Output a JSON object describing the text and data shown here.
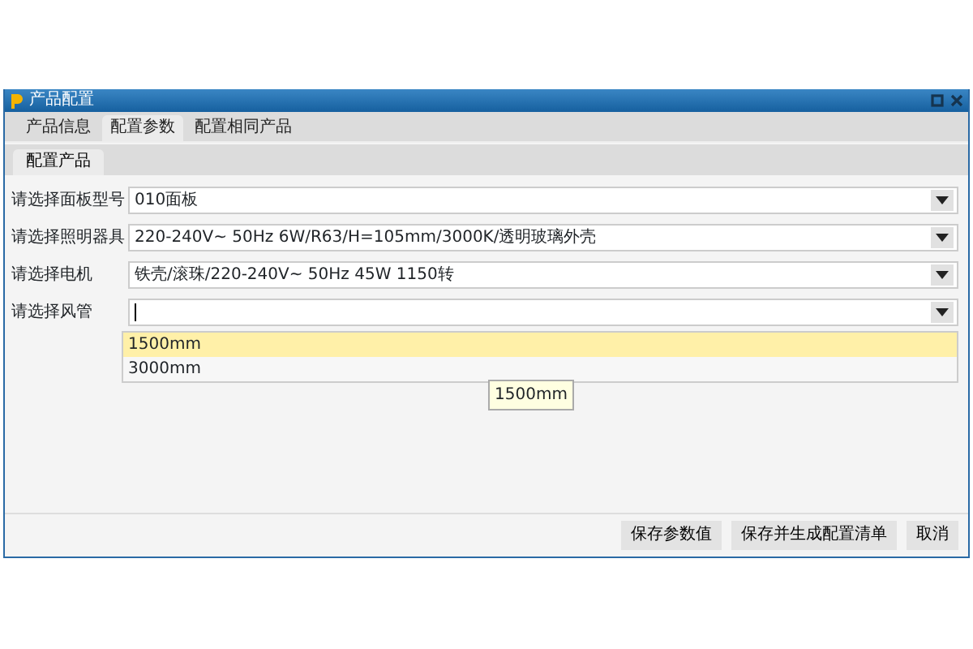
{
  "window": {
    "title": "产品配置"
  },
  "tabs": [
    {
      "label": "产品信息",
      "selected": false
    },
    {
      "label": "配置参数",
      "selected": true
    },
    {
      "label": "配置相同产品",
      "selected": false
    }
  ],
  "subtabs": [
    {
      "label": "配置产品",
      "selected": true
    }
  ],
  "fields": [
    {
      "label": "请选择面板型号",
      "value": "010面板",
      "expanded": false
    },
    {
      "label": "请选择照明器具",
      "value": "220-240V~ 50Hz 6W/R63/H=105mm/3000K/透明玻璃外壳",
      "expanded": false
    },
    {
      "label": "请选择电机",
      "value": "铁壳/滚珠/220-240V~ 50Hz 45W 1150转",
      "expanded": false
    },
    {
      "label": "请选择风管",
      "expanded": true,
      "options": [
        {
          "label": "1500mm",
          "selected": true
        },
        {
          "label": "3000mm",
          "selected": false
        }
      ]
    }
  ],
  "tooltip": "1500mm",
  "buttons": [
    "保存参数值",
    "保存并生成配置清单",
    "取消"
  ]
}
